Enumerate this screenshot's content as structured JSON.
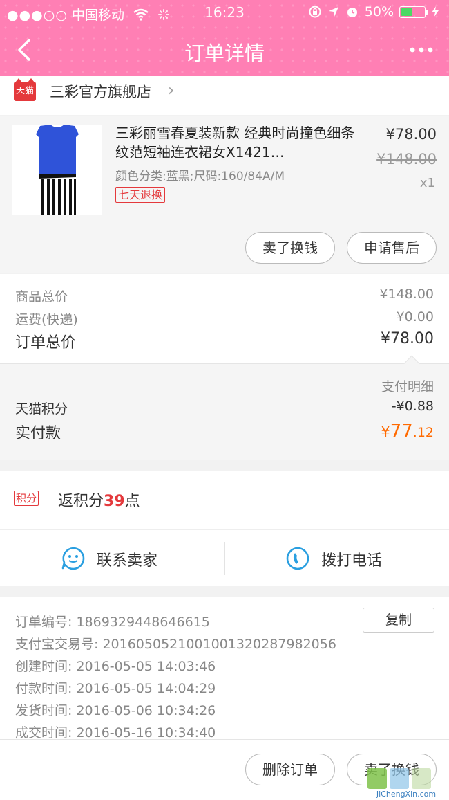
{
  "status_bar": {
    "signal_dots": "●●●○○",
    "carrier": "中国移动",
    "time": "16:23",
    "battery_text": "50%",
    "battery_level": 0.5
  },
  "nav": {
    "title": "订单详情"
  },
  "shop": {
    "badge": "天猫",
    "name": "三彩官方旗舰店"
  },
  "product": {
    "title": "三彩丽雪春夏装新款 经典时尚撞色细条纹范短袖连衣裙女X1421…",
    "spec": "颜色分类:蓝黑;尺码:160/84A/M",
    "tag": "七天退换",
    "price": "¥78.00",
    "original_price": "¥148.00",
    "quantity": "x1",
    "sell_button": "卖了换钱",
    "aftersale_button": "申请售后"
  },
  "totals": {
    "goods_label": "商品总价",
    "goods_value": "¥148.00",
    "shipping_label": "运费(快递)",
    "shipping_value": "¥0.00",
    "order_total_label": "订单总价",
    "order_total_value": "¥78.00"
  },
  "payment": {
    "detail_label": "支付明细",
    "points_label": "天猫积分",
    "points_value": "-¥0.88",
    "paid_label": "实付款",
    "paid_currency": "¥",
    "paid_int": "77",
    "paid_dec": ".12"
  },
  "points": {
    "badge": "积分",
    "text_prefix": "返积分",
    "value": "39",
    "text_suffix": "点"
  },
  "contact": {
    "seller_label": "联系卖家",
    "call_label": "拨打电话"
  },
  "info": {
    "order_no_label": "订单编号:",
    "order_no": "1869329448646615",
    "copy_button": "复制",
    "alipay_label": "支付宝交易号:",
    "alipay_no": "2016050521001001320287982056",
    "created_label": "创建时间:",
    "created": "2016-05-05 14:03:46",
    "paid_label": "付款时间:",
    "paid": "2016-05-05 14:04:29",
    "shipped_label": "发货时间:",
    "shipped": "2016-05-06 10:34:26",
    "closed_label": "成交时间:",
    "closed": "2016-05-16 10:34:40"
  },
  "footer": {
    "delete_button": "删除订单",
    "sell_button": "卖了换钱"
  },
  "watermark": {
    "text": "JiChengXin.com"
  },
  "colors": {
    "nav_pink": "#ff7fb4",
    "tmall_red": "#e4393c",
    "paid_orange": "#ff6a00",
    "icon_blue": "#2a9fe0"
  }
}
